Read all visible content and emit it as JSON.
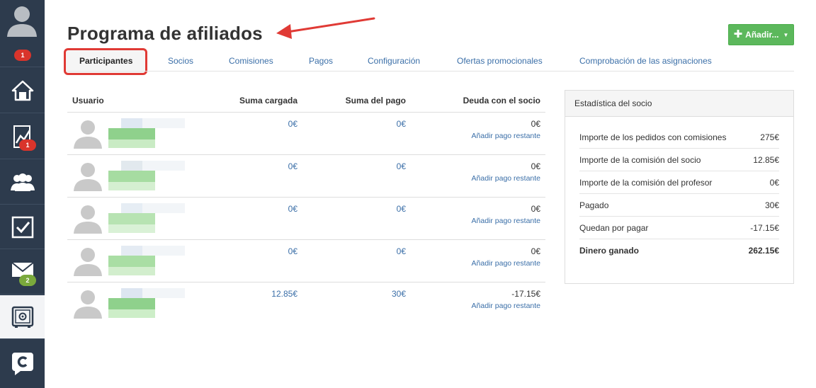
{
  "sidebar": {
    "items": [
      {
        "name": "user-avatar",
        "badge": "1",
        "badge_color": "#d9342b"
      },
      {
        "name": "home"
      },
      {
        "name": "stats",
        "badge": "1",
        "badge_color": "#d9342b"
      },
      {
        "name": "users"
      },
      {
        "name": "tasks"
      },
      {
        "name": "mail",
        "badge": "2",
        "badge_color": "#7aa93c"
      },
      {
        "name": "safe",
        "active": true
      },
      {
        "name": "brand-logo"
      }
    ]
  },
  "header": {
    "title": "Programa de afiliados",
    "add_button": "Añadir..."
  },
  "tabs": [
    {
      "label": "Participantes",
      "active": true
    },
    {
      "label": "Socios"
    },
    {
      "label": "Comisiones"
    },
    {
      "label": "Pagos"
    },
    {
      "label": "Configuración"
    },
    {
      "label": "Ofertas promocionales"
    },
    {
      "label": "Comprobación de las asignaciones"
    }
  ],
  "table": {
    "columns": [
      "Usuario",
      "Suma cargada",
      "Suma del pago",
      "Deuda con el socio"
    ],
    "pay_link": "Añadir pago restante",
    "rows": [
      {
        "charged": "0€",
        "paid": "0€",
        "debt": "0€"
      },
      {
        "charged": "0€",
        "paid": "0€",
        "debt": "0€"
      },
      {
        "charged": "0€",
        "paid": "0€",
        "debt": "0€"
      },
      {
        "charged": "0€",
        "paid": "0€",
        "debt": "0€"
      },
      {
        "charged": "12.85€",
        "paid": "30€",
        "debt": "-17.15€"
      }
    ]
  },
  "stats": {
    "title": "Estadística del socio",
    "rows": [
      {
        "label": "Importe de los pedidos con comisiones",
        "value": "275€"
      },
      {
        "label": "Importe de la comisión del socio",
        "value": "12.85€"
      },
      {
        "label": "Importe de la comisión del profesor",
        "value": "0€"
      },
      {
        "label": "Pagado",
        "value": "30€"
      },
      {
        "label": "Quedan por pagar",
        "value": "-17.15€"
      },
      {
        "label": "Dinero ganado",
        "value": "262.15€"
      }
    ]
  },
  "colors": {
    "accent": "#3b6fa8",
    "sidebar": "#2d3b4d",
    "success": "#5cb85c",
    "highlight": "#e03a35"
  }
}
